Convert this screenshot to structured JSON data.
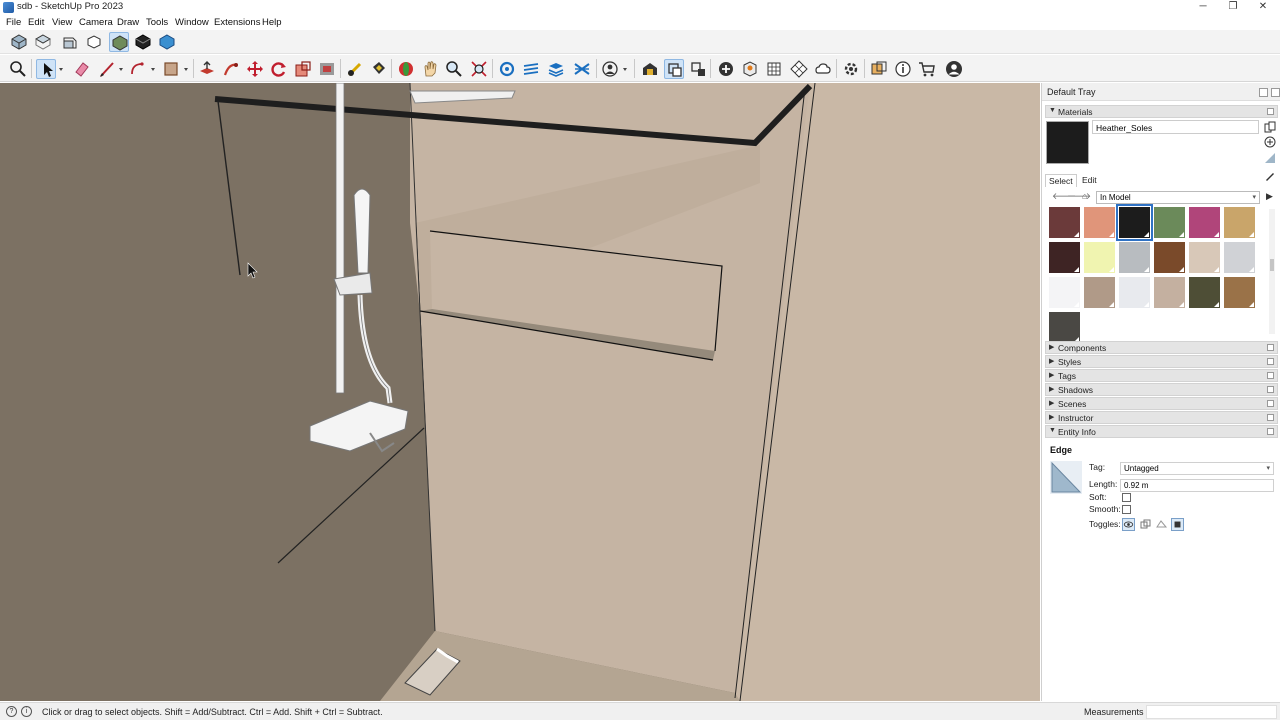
{
  "window": {
    "title": "sdb - SketchUp Pro 2023",
    "minimize_glyph": "─",
    "maximize_glyph": "❐",
    "close_glyph": "✕"
  },
  "menu": [
    "File",
    "Edit",
    "View",
    "Camera",
    "Draw",
    "Tools",
    "Window",
    "Extensions",
    "Help"
  ],
  "toolbar": {
    "row1_icons": [
      "iso-view-icon",
      "top-view-icon",
      "front-view-icon",
      "right-view-icon",
      "back-view-icon",
      "shaded-icon",
      "xray-icon"
    ],
    "row2_icons": [
      "zoom-icon",
      "select-icon",
      "eraser-icon",
      "line-icon",
      "arc-icon",
      "rectangle-icon",
      "push-pull-icon",
      "follow-me-icon",
      "move-icon",
      "rotate-icon",
      "scale-icon",
      "offset-icon",
      "tape-measure-icon",
      "paint-bucket-icon",
      "orbit-icon",
      "pan-icon",
      "zoom-window-icon",
      "zoom-extents-icon",
      "section-plane-icon",
      "display-section-planes-icon",
      "section-fill-icon",
      "display-section-cuts-icon",
      "account-icon",
      "warehouse-icon",
      "components-icon",
      "styles-icon",
      "add-location-icon",
      "photo-textures-icon",
      "layout-icon",
      "extension-warehouse-icon",
      "trimble-connect-icon",
      "extension-manager-icon",
      "solid-tools-icon",
      "info-icon",
      "cart-icon",
      "profile-icon"
    ]
  },
  "tray": {
    "title": "Default Tray",
    "materials": {
      "header": "Materials",
      "current_name": "Heather_Soles",
      "tab_select": "Select",
      "tab_edit": "Edit",
      "library": "In Model",
      "swatches": [
        {
          "color": "#6b3a3a"
        },
        {
          "color": "#e0957a"
        },
        {
          "color": "#1c1c1c",
          "selected": true
        },
        {
          "color": "#6b8a5a"
        },
        {
          "color": "#b0457a"
        },
        {
          "color": "#c9a56a"
        },
        {
          "color": "#3e2424"
        },
        {
          "color": "#f0f4b0"
        },
        {
          "color": "#b8bcc0"
        },
        {
          "color": "#7a4a2a"
        },
        {
          "color": "#d8c8b8"
        },
        {
          "color": "#d0d2d6"
        },
        {
          "color": "#f4f4f6"
        },
        {
          "color": "#b09a88"
        },
        {
          "color": "#e8eaee"
        },
        {
          "color": "#c4b0a0"
        },
        {
          "color": "#4e4e36"
        },
        {
          "color": "#9a7248"
        },
        {
          "color": "#4a4844"
        }
      ]
    },
    "panels": [
      "Components",
      "Styles",
      "Tags",
      "Shadows",
      "Scenes",
      "Instructor"
    ],
    "entity_info": {
      "header": "Entity Info",
      "type": "Edge",
      "tag_label": "Tag:",
      "tag_value": "Untagged",
      "length_label": "Length:",
      "length_value": "0.92 m",
      "soft_label": "Soft:",
      "soft_checked": false,
      "smooth_label": "Smooth:",
      "smooth_checked": false,
      "toggles_label": "Toggles:"
    }
  },
  "status": {
    "text": "Click or drag to select objects. Shift = Add/Subtract. Ctrl = Add. Shift + Ctrl = Subtract.",
    "measurements_label": "Measurements",
    "measurements_value": ""
  }
}
